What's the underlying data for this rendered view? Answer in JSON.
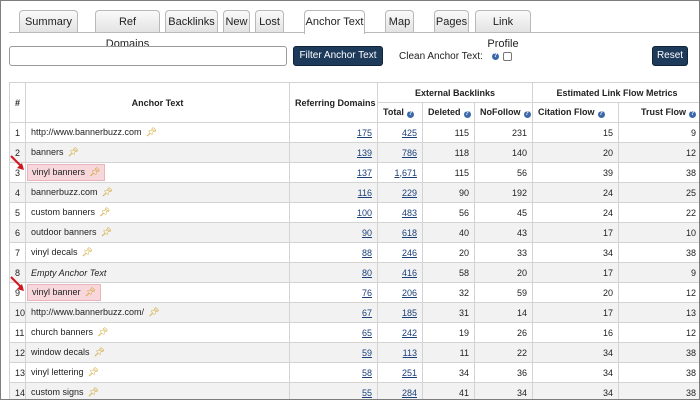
{
  "tabs": [
    {
      "label": "Summary"
    },
    {
      "label": "Ref Domains"
    },
    {
      "label": "Backlinks"
    },
    {
      "label": "New"
    },
    {
      "label": "Lost"
    },
    {
      "label": "Anchor Text"
    },
    {
      "label": "Map"
    },
    {
      "label": "Pages"
    },
    {
      "label": "Link Profile"
    }
  ],
  "toolbar": {
    "search_value": "",
    "filter_label": "Filter Anchor Text",
    "clean_label": "Clean Anchor Text:",
    "clean_checked": false,
    "reset_label": "Reset",
    "help_glyph": "?"
  },
  "table": {
    "headers": {
      "num": "#",
      "anchor": "Anchor Text",
      "referring": "Referring Domains",
      "external": "External Backlinks",
      "total": "Total",
      "deleted": "Deleted",
      "nofollow": "NoFollow",
      "estimated": "Estimated Link Flow Metrics",
      "citation": "Citation Flow",
      "trust": "Trust Flow"
    },
    "rows": [
      {
        "num": "1",
        "anchor": "http://www.bannerbuzz.com",
        "ref": "175",
        "total": "425",
        "deleted": "115",
        "nofollow": "231",
        "citation": "15",
        "trust": "9",
        "highlight": false
      },
      {
        "num": "2",
        "anchor": "banners",
        "ref": "139",
        "total": "786",
        "deleted": "118",
        "nofollow": "140",
        "citation": "20",
        "trust": "12",
        "highlight": false
      },
      {
        "num": "3",
        "anchor": "vinyl banners",
        "ref": "137",
        "total": "1,671",
        "deleted": "115",
        "nofollow": "56",
        "citation": "39",
        "trust": "38",
        "highlight": true
      },
      {
        "num": "4",
        "anchor": "bannerbuzz.com",
        "ref": "116",
        "total": "229",
        "deleted": "90",
        "nofollow": "192",
        "citation": "24",
        "trust": "25",
        "highlight": false
      },
      {
        "num": "5",
        "anchor": "custom banners",
        "ref": "100",
        "total": "483",
        "deleted": "56",
        "nofollow": "45",
        "citation": "24",
        "trust": "22",
        "highlight": false
      },
      {
        "num": "6",
        "anchor": "outdoor banners",
        "ref": "90",
        "total": "618",
        "deleted": "40",
        "nofollow": "43",
        "citation": "17",
        "trust": "10",
        "highlight": false
      },
      {
        "num": "7",
        "anchor": "vinyl decals",
        "ref": "88",
        "total": "246",
        "deleted": "20",
        "nofollow": "33",
        "citation": "34",
        "trust": "38",
        "highlight": false
      },
      {
        "num": "8",
        "anchor": "Empty Anchor Text",
        "ref": "80",
        "total": "416",
        "deleted": "58",
        "nofollow": "20",
        "citation": "17",
        "trust": "9",
        "highlight": false,
        "empty": true
      },
      {
        "num": "9",
        "anchor": "vinyl banner",
        "ref": "76",
        "total": "206",
        "deleted": "32",
        "nofollow": "59",
        "citation": "20",
        "trust": "12",
        "highlight": true
      },
      {
        "num": "10",
        "anchor": "http://www.bannerbuzz.com/",
        "ref": "67",
        "total": "185",
        "deleted": "31",
        "nofollow": "14",
        "citation": "17",
        "trust": "13",
        "highlight": false
      },
      {
        "num": "11",
        "anchor": "church banners",
        "ref": "65",
        "total": "242",
        "deleted": "19",
        "nofollow": "26",
        "citation": "16",
        "trust": "12",
        "highlight": false
      },
      {
        "num": "12",
        "anchor": "window decals",
        "ref": "59",
        "total": "113",
        "deleted": "11",
        "nofollow": "22",
        "citation": "34",
        "trust": "38",
        "highlight": false
      },
      {
        "num": "13",
        "anchor": "vinyl lettering",
        "ref": "58",
        "total": "251",
        "deleted": "34",
        "nofollow": "36",
        "citation": "34",
        "trust": "38",
        "highlight": false
      },
      {
        "num": "14",
        "anchor": "custom signs",
        "ref": "55",
        "total": "284",
        "deleted": "41",
        "nofollow": "34",
        "citation": "34",
        "trust": "38",
        "highlight": false
      }
    ]
  },
  "icons": {
    "pin": "pin-icon",
    "arrow": "red-arrow-icon"
  },
  "colors": {
    "button": "#1e3a5b",
    "link": "#1b3f78",
    "highlight": "#f8d7dc",
    "arrow": "#d0171f"
  }
}
